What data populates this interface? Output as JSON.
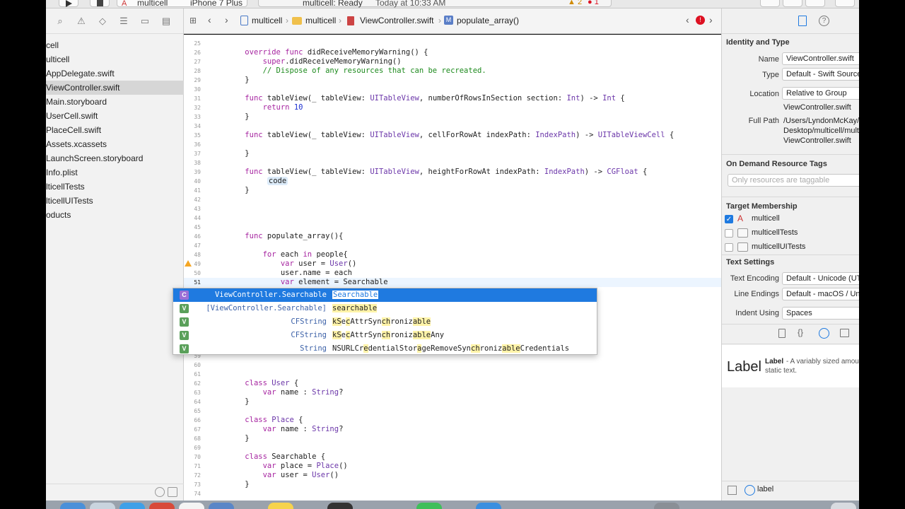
{
  "toolbar": {
    "scheme": "multicell",
    "device": "iPhone 7 Plus",
    "status": "multicell: Ready",
    "status_time": "Today at 10:33 AM",
    "warnings": "2",
    "errors": "1"
  },
  "navigator": {
    "items": [
      {
        "label": "cell",
        "selected": false
      },
      {
        "label": "ulticell",
        "selected": false
      },
      {
        "label": "AppDelegate.swift",
        "selected": false
      },
      {
        "label": "ViewController.swift",
        "selected": true
      },
      {
        "label": "Main.storyboard",
        "selected": false
      },
      {
        "label": "UserCell.swift",
        "selected": false
      },
      {
        "label": "PlaceCell.swift",
        "selected": false
      },
      {
        "label": "Assets.xcassets",
        "selected": false
      },
      {
        "label": "LaunchScreen.storyboard",
        "selected": false
      },
      {
        "label": "Info.plist",
        "selected": false
      },
      {
        "label": "lticellTests",
        "selected": false
      },
      {
        "label": "lticellUITests",
        "selected": false
      },
      {
        "label": "oducts",
        "selected": false
      }
    ]
  },
  "jumpbar": {
    "project": "multicell",
    "group": "multicell",
    "file": "ViewController.swift",
    "symbol_badge": "M",
    "symbol": "populate_array()"
  },
  "editor": {
    "lines": [
      {
        "n": "25",
        "t": ""
      },
      {
        "n": "26",
        "t": "    override func didReceiveMemoryWarning() {"
      },
      {
        "n": "27",
        "t": "        super.didReceiveMemoryWarning()"
      },
      {
        "n": "28",
        "t": "        // Dispose of any resources that can be recreated."
      },
      {
        "n": "29",
        "t": "    }"
      },
      {
        "n": "30",
        "t": ""
      },
      {
        "n": "31",
        "t": "    func tableView(_ tableView: UITableView, numberOfRowsInSection section: Int) -> Int {"
      },
      {
        "n": "32",
        "t": "        return 10"
      },
      {
        "n": "33",
        "t": "    }"
      },
      {
        "n": "34",
        "t": ""
      },
      {
        "n": "35",
        "t": "    func tableView(_ tableView: UITableView, cellForRowAt indexPath: IndexPath) -> UITableViewCell {"
      },
      {
        "n": "36",
        "t": ""
      },
      {
        "n": "37",
        "t": "    }"
      },
      {
        "n": "38",
        "t": ""
      },
      {
        "n": "39",
        "t": "    func tableView(_ tableView: UITableView, heightForRowAt indexPath: IndexPath) -> CGFloat {"
      },
      {
        "n": "40",
        "t": "         code "
      },
      {
        "n": "41",
        "t": "    }"
      },
      {
        "n": "42",
        "t": ""
      },
      {
        "n": "43",
        "t": ""
      },
      {
        "n": "44",
        "t": ""
      },
      {
        "n": "45",
        "t": ""
      },
      {
        "n": "46",
        "t": "    func populate_array(){"
      },
      {
        "n": "47",
        "t": ""
      },
      {
        "n": "48",
        "t": "        for each in people{"
      },
      {
        "n": "49",
        "t": "            var user = User()"
      },
      {
        "n": "50",
        "t": "            user.name = each"
      },
      {
        "n": "51",
        "t": "            var element = Searchable"
      },
      {
        "n": "52",
        "t": ""
      },
      {
        "n": "53",
        "t": ""
      },
      {
        "n": "54",
        "t": ""
      },
      {
        "n": "55",
        "t": ""
      },
      {
        "n": "56",
        "t": ""
      },
      {
        "n": "57",
        "t": ""
      },
      {
        "n": "58",
        "t": ""
      },
      {
        "n": "59",
        "t": ""
      },
      {
        "n": "60",
        "t": ""
      },
      {
        "n": "61",
        "t": ""
      },
      {
        "n": "62",
        "t": "    class User {"
      },
      {
        "n": "63",
        "t": "        var name : String?"
      },
      {
        "n": "64",
        "t": "    }"
      },
      {
        "n": "65",
        "t": ""
      },
      {
        "n": "66",
        "t": "    class Place {"
      },
      {
        "n": "67",
        "t": "        var name : String?"
      },
      {
        "n": "68",
        "t": "    }"
      },
      {
        "n": "69",
        "t": ""
      },
      {
        "n": "70",
        "t": "    class Searchable {"
      },
      {
        "n": "71",
        "t": "        var place = Place()"
      },
      {
        "n": "72",
        "t": "        var user = User()"
      },
      {
        "n": "73",
        "t": "    }"
      },
      {
        "n": "74",
        "t": ""
      }
    ],
    "current_line": "51",
    "warning_line": "49"
  },
  "autocomplete": {
    "items": [
      {
        "badge": "C",
        "badge_color": "#9b6fd6",
        "type": "ViewController.Searchable",
        "name": "Searchable",
        "selected": true
      },
      {
        "badge": "V",
        "badge_color": "#5aa05a",
        "type": "[ViewController.Searchable]",
        "name": "searchable",
        "selected": false
      },
      {
        "badge": "V",
        "badge_color": "#5aa05a",
        "type": "CFString",
        "name": "kSecAttrSynchronizable",
        "selected": false
      },
      {
        "badge": "V",
        "badge_color": "#5aa05a",
        "type": "CFString",
        "name": "kSecAttrSynchronizableAny",
        "selected": false
      },
      {
        "badge": "V",
        "badge_color": "#5aa05a",
        "type": "String",
        "name": "NSURLCredentialStorageRemoveSynchronizableCredentials",
        "selected": false
      }
    ]
  },
  "inspector": {
    "identity_title": "Identity and Type",
    "name_label": "Name",
    "name_value": "ViewController.swift",
    "type_label": "Type",
    "type_value": "Default - Swift Source",
    "location_label": "Location",
    "location_value": "Relative to Group",
    "location_file": "ViewController.swift",
    "full_path_label": "Full Path",
    "full_path_1": "/Users/LyndonMcKay/",
    "full_path_2": "Desktop/multicell/multicell/",
    "full_path_3": "ViewController.swift",
    "odr_title": "On Demand Resource Tags",
    "odr_placeholder": "Only resources are taggable",
    "target_title": "Target Membership",
    "targets": [
      {
        "label": "multicell",
        "checked": true
      },
      {
        "label": "multicellTests",
        "checked": false
      },
      {
        "label": "multicellUITests",
        "checked": false
      }
    ],
    "text_settings_title": "Text Settings",
    "encoding_label": "Text Encoding",
    "encoding_value": "Default - Unicode (UTF-8)",
    "endings_label": "Line Endings",
    "endings_value": "Default - macOS / Unix (LF)",
    "indent_label": "Indent Using",
    "indent_value": "Spaces",
    "library_item_title": "Label",
    "library_item_name": "Label",
    "library_item_desc_1": " - A variably sized amount of",
    "library_item_desc_2": "static text.",
    "filter_value": "label"
  }
}
